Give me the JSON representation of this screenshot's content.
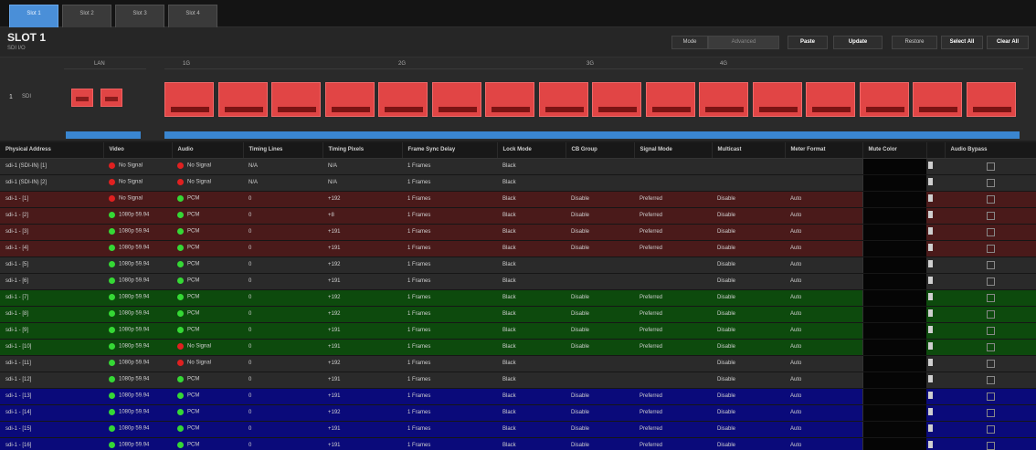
{
  "tabs": [
    {
      "label": "Slot 1"
    },
    {
      "label": "Slot 2"
    },
    {
      "label": "Slot 3"
    },
    {
      "label": "Slot 4"
    }
  ],
  "header": {
    "title": "SLOT 1",
    "subtitle": "SDI I/O",
    "buttons": {
      "mode_a": "Mode",
      "mode_b": "Advanced",
      "paste": "Paste",
      "update": "Update",
      "restore": "Restore",
      "select_all": "Select All",
      "clear_all": "Clear All"
    }
  },
  "routing": {
    "group_labels": [
      "LAN",
      "1G",
      "2G",
      "3G",
      "4G"
    ],
    "row_index": "1",
    "row_name": "SDI",
    "input_blocks": 2,
    "output_blocks": 16
  },
  "table": {
    "columns": [
      "Physical Address",
      "Video",
      "Audio",
      "Timing Lines",
      "Timing Pixels",
      "Frame Sync Delay",
      "Lock Mode",
      "CB Group",
      "Signal Mode",
      "Multicast",
      "Meter Format",
      "Mute Color",
      "",
      "Audio Bypass"
    ],
    "rows": [
      {
        "addr": "sdi-1 (SDI-IN) [1]",
        "video_state": "red",
        "video": "No Signal",
        "audio_state": "red",
        "audio": "No Signal",
        "tl": "N/A",
        "tp": "N/A",
        "fsd": "1 Frames",
        "lock": "Black",
        "cb": "",
        "sig": "",
        "mc": "",
        "mf": "",
        "color": "gray"
      },
      {
        "addr": "sdi-1 (SDI-IN) [2]",
        "video_state": "red",
        "video": "No Signal",
        "audio_state": "red",
        "audio": "No Signal",
        "tl": "N/A",
        "tp": "N/A",
        "fsd": "1 Frames",
        "lock": "Black",
        "cb": "",
        "sig": "",
        "mc": "",
        "mf": "",
        "color": "gray"
      },
      {
        "addr": "sdi-1 - [1]",
        "video_state": "red",
        "video": "No Signal",
        "audio_state": "green",
        "audio": "PCM",
        "tl": "0",
        "tp": "+192",
        "fsd": "1 Frames",
        "lock": "Black",
        "cb": "Disable",
        "sig": "Preferred",
        "mc": "Disable",
        "mf": "Auto",
        "color": "red"
      },
      {
        "addr": "sdi-1 - [2]",
        "video_state": "green",
        "video": "1080p 59.94",
        "audio_state": "green",
        "audio": "PCM",
        "tl": "0",
        "tp": "+8",
        "fsd": "1 Frames",
        "lock": "Black",
        "cb": "Disable",
        "sig": "Preferred",
        "mc": "Disable",
        "mf": "Auto",
        "color": "red"
      },
      {
        "addr": "sdi-1 - [3]",
        "video_state": "green",
        "video": "1080p 59.94",
        "audio_state": "green",
        "audio": "PCM",
        "tl": "0",
        "tp": "+191",
        "fsd": "1 Frames",
        "lock": "Black",
        "cb": "Disable",
        "sig": "Preferred",
        "mc": "Disable",
        "mf": "Auto",
        "color": "red"
      },
      {
        "addr": "sdi-1 - [4]",
        "video_state": "green",
        "video": "1080p 59.94",
        "audio_state": "green",
        "audio": "PCM",
        "tl": "0",
        "tp": "+191",
        "fsd": "1 Frames",
        "lock": "Black",
        "cb": "Disable",
        "sig": "Preferred",
        "mc": "Disable",
        "mf": "Auto",
        "color": "red"
      },
      {
        "addr": "sdi-1 - [5]",
        "video_state": "green",
        "video": "1080p 59.94",
        "audio_state": "green",
        "audio": "PCM",
        "tl": "0",
        "tp": "+192",
        "fsd": "1 Frames",
        "lock": "Black",
        "cb": "",
        "sig": "",
        "mc": "Disable",
        "mf": "Auto",
        "color": "gray"
      },
      {
        "addr": "sdi-1 - [6]",
        "video_state": "green",
        "video": "1080p 59.94",
        "audio_state": "green",
        "audio": "PCM",
        "tl": "0",
        "tp": "+191",
        "fsd": "1 Frames",
        "lock": "Black",
        "cb": "",
        "sig": "",
        "mc": "Disable",
        "mf": "Auto",
        "color": "gray"
      },
      {
        "addr": "sdi-1 - [7]",
        "video_state": "green",
        "video": "1080p 59.94",
        "audio_state": "green",
        "audio": "PCM",
        "tl": "0",
        "tp": "+192",
        "fsd": "1 Frames",
        "lock": "Black",
        "cb": "Disable",
        "sig": "Preferred",
        "mc": "Disable",
        "mf": "Auto",
        "color": "green"
      },
      {
        "addr": "sdi-1 - [8]",
        "video_state": "green",
        "video": "1080p 59.94",
        "audio_state": "green",
        "audio": "PCM",
        "tl": "0",
        "tp": "+192",
        "fsd": "1 Frames",
        "lock": "Black",
        "cb": "Disable",
        "sig": "Preferred",
        "mc": "Disable",
        "mf": "Auto",
        "color": "green"
      },
      {
        "addr": "sdi-1 - [9]",
        "video_state": "green",
        "video": "1080p 59.94",
        "audio_state": "green",
        "audio": "PCM",
        "tl": "0",
        "tp": "+191",
        "fsd": "1 Frames",
        "lock": "Black",
        "cb": "Disable",
        "sig": "Preferred",
        "mc": "Disable",
        "mf": "Auto",
        "color": "green"
      },
      {
        "addr": "sdi-1 - [10]",
        "video_state": "green",
        "video": "1080p 59.94",
        "audio_state": "red",
        "audio": "No Signal",
        "tl": "0",
        "tp": "+191",
        "fsd": "1 Frames",
        "lock": "Black",
        "cb": "Disable",
        "sig": "Preferred",
        "mc": "Disable",
        "mf": "Auto",
        "color": "green"
      },
      {
        "addr": "sdi-1 - [11]",
        "video_state": "green",
        "video": "1080p 59.94",
        "audio_state": "red",
        "audio": "No Signal",
        "tl": "0",
        "tp": "+192",
        "fsd": "1 Frames",
        "lock": "Black",
        "cb": "",
        "sig": "",
        "mc": "Disable",
        "mf": "Auto",
        "color": "gray"
      },
      {
        "addr": "sdi-1 - [12]",
        "video_state": "green",
        "video": "1080p 59.94",
        "audio_state": "green",
        "audio": "PCM",
        "tl": "0",
        "tp": "+191",
        "fsd": "1 Frames",
        "lock": "Black",
        "cb": "",
        "sig": "",
        "mc": "Disable",
        "mf": "Auto",
        "color": "gray"
      },
      {
        "addr": "sdi-1 - [13]",
        "video_state": "green",
        "video": "1080p 59.94",
        "audio_state": "green",
        "audio": "PCM",
        "tl": "0",
        "tp": "+191",
        "fsd": "1 Frames",
        "lock": "Black",
        "cb": "Disable",
        "sig": "Preferred",
        "mc": "Disable",
        "mf": "Auto",
        "color": "blue"
      },
      {
        "addr": "sdi-1 - [14]",
        "video_state": "green",
        "video": "1080p 59.94",
        "audio_state": "green",
        "audio": "PCM",
        "tl": "0",
        "tp": "+192",
        "fsd": "1 Frames",
        "lock": "Black",
        "cb": "Disable",
        "sig": "Preferred",
        "mc": "Disable",
        "mf": "Auto",
        "color": "blue"
      },
      {
        "addr": "sdi-1 - [15]",
        "video_state": "green",
        "video": "1080p 59.94",
        "audio_state": "green",
        "audio": "PCM",
        "tl": "0",
        "tp": "+191",
        "fsd": "1 Frames",
        "lock": "Black",
        "cb": "Disable",
        "sig": "Preferred",
        "mc": "Disable",
        "mf": "Auto",
        "color": "blue"
      },
      {
        "addr": "sdi-1 - [16]",
        "video_state": "green",
        "video": "1080p 59.94",
        "audio_state": "green",
        "audio": "PCM",
        "tl": "0",
        "tp": "+191",
        "fsd": "1 Frames",
        "lock": "Black",
        "cb": "Disable",
        "sig": "Preferred",
        "mc": "Disable",
        "mf": "Auto",
        "color": "blue"
      }
    ]
  }
}
